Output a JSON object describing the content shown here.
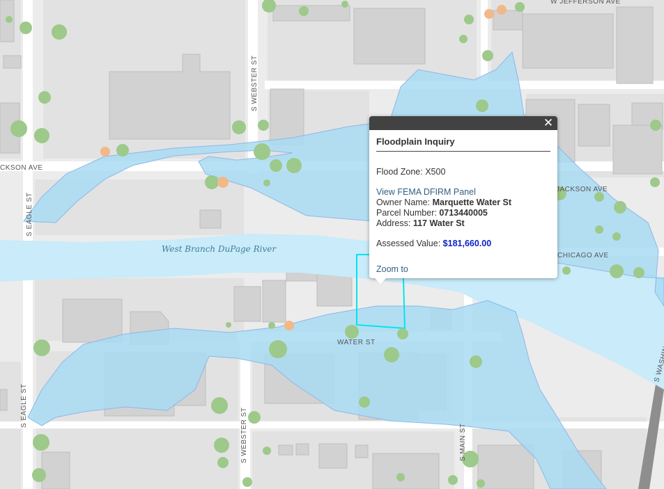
{
  "streets": {
    "jefferson": "W JEFFERSON AVE",
    "jackson_left": "CKSON AVE",
    "jackson_right": "JACKSON AVE",
    "chicago": "CHICAGO AVE",
    "webster_top": "S WEBSTER ST",
    "webster_bottom": "S WEBSTER ST",
    "eagle_top": "S EAGLE ST",
    "eagle_bottom": "S EAGLE ST",
    "water": "WATER ST",
    "main": "S MAIN ST",
    "washington": "S WASHINGT"
  },
  "river_label": "West Branch DuPage River",
  "colors": {
    "floodplain_fill": "#a9dcf3",
    "river_fill": "#c9ebfa",
    "selection": "#00e5ee",
    "building": "#d2d2d2",
    "road": "#ffffff",
    "rail": "#8e8e8e"
  },
  "popup": {
    "close_icon": "close-icon",
    "close_glyph": "✕",
    "title": "Floodplain Inquiry",
    "flood_zone_label": "Flood Zone:",
    "flood_zone_value": "X500",
    "fema_link": "View FEMA DFIRM Panel",
    "owner_label": "Owner Name:",
    "owner_value": "Marquette Water St",
    "parcel_label": "Parcel Number:",
    "parcel_value": "0713440005",
    "address_label": "Address:",
    "address_value": "117 Water St",
    "assessed_label": "Assessed Value:",
    "assessed_value": "$181,660.00",
    "zoom_link": "Zoom to"
  }
}
